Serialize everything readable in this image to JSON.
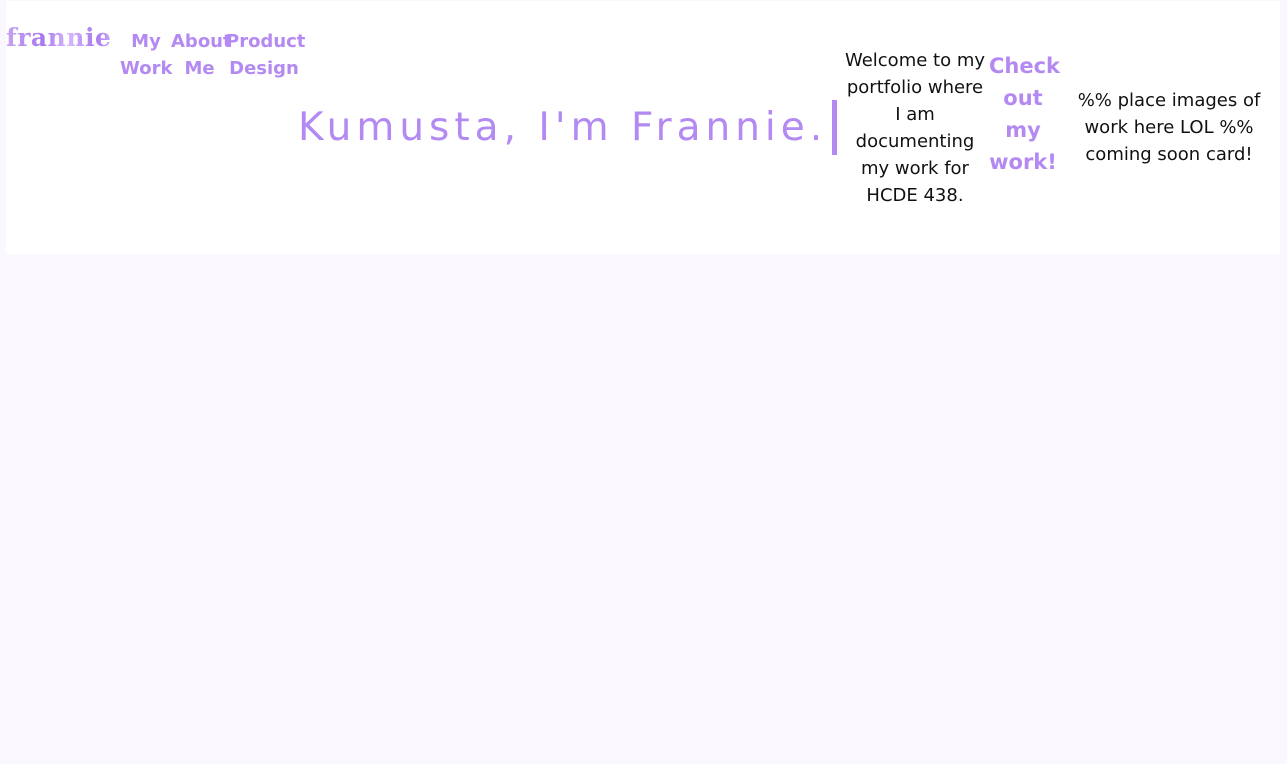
{
  "colors": {
    "accent": "#b48af2",
    "page_background": "#faf7ff",
    "panel_background": "#ffffff",
    "body_text": "#111111"
  },
  "header": {
    "logo_text": "frannie",
    "nav": [
      {
        "label": "My Work"
      },
      {
        "label": "About Me"
      },
      {
        "label": "Product Design"
      }
    ]
  },
  "hero": {
    "title": "Kumusta, I'm Frannie."
  },
  "intro": {
    "welcome": "Welcome to my portfolio where I am documenting my work for HCDE 438.",
    "cta": "Check out my work!"
  },
  "work_placeholder": {
    "text": "%% place images of work here LOL %% coming soon card!"
  }
}
